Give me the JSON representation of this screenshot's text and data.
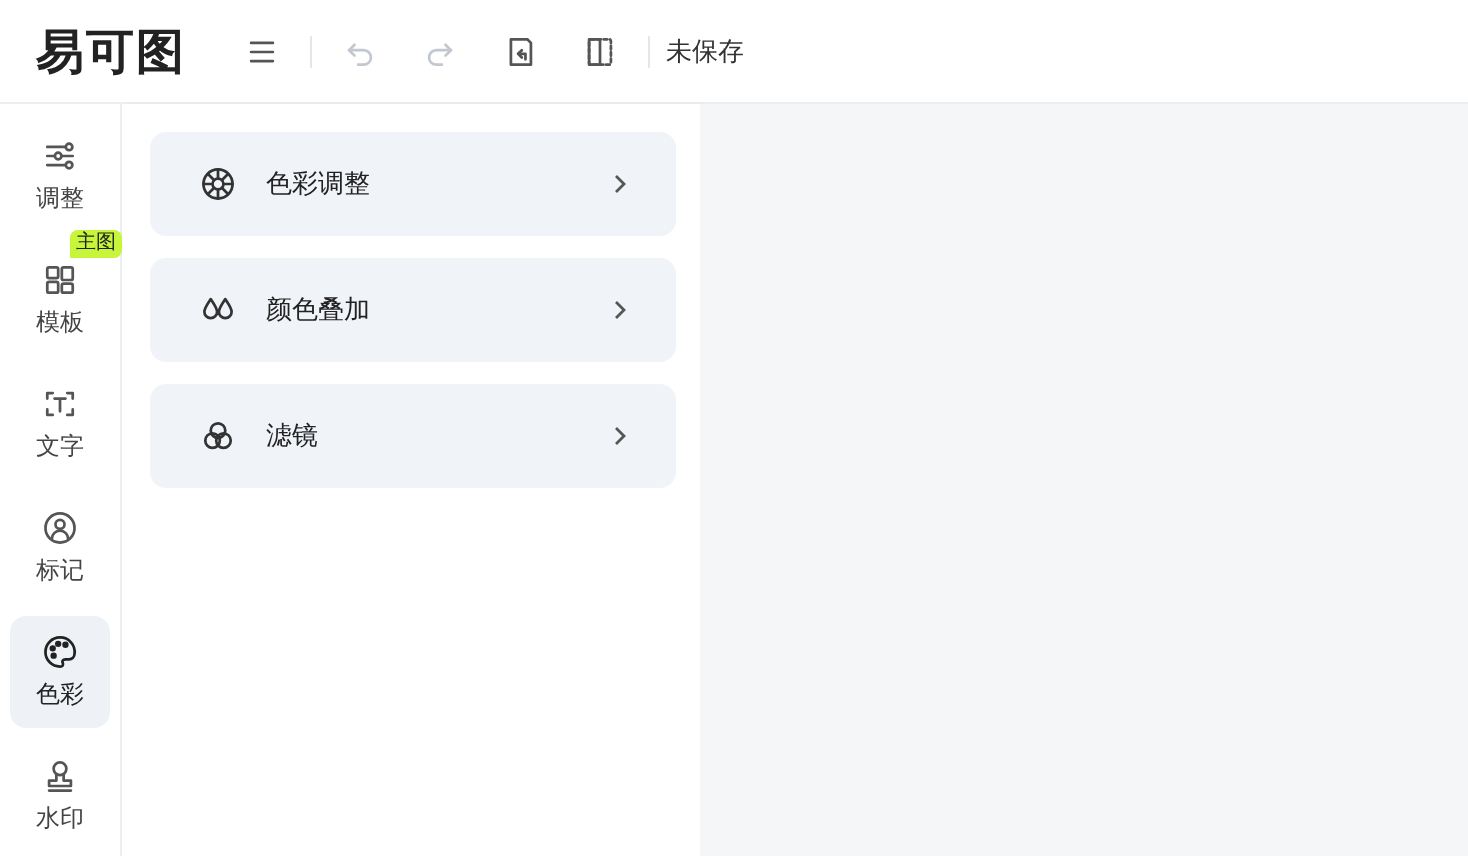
{
  "header": {
    "logo": "易可图",
    "save_status": "未保存",
    "tools": [
      {
        "disabled": false
      },
      {
        "disabled": true
      },
      {
        "disabled": true
      },
      {
        "disabled": false
      },
      {
        "disabled": false
      }
    ]
  },
  "sidebar": {
    "items": [
      {
        "label": "调整",
        "selected": false
      },
      {
        "label": "模板",
        "selected": false,
        "badge": "主图"
      },
      {
        "label": "文字",
        "selected": false
      },
      {
        "label": "标记",
        "selected": false
      },
      {
        "label": "色彩",
        "selected": true
      },
      {
        "label": "水印",
        "selected": false
      }
    ]
  },
  "panel": {
    "items": [
      {
        "label": "色彩调整"
      },
      {
        "label": "颜色叠加"
      },
      {
        "label": "滤镜"
      }
    ]
  }
}
